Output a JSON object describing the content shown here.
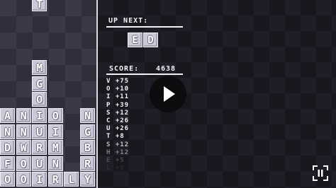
{
  "board": {
    "tiles": [
      {
        "letter": "T",
        "col": 2,
        "row": 0
      },
      {
        "letter": "M",
        "col": 2,
        "row": 4
      },
      {
        "letter": "G",
        "col": 2,
        "row": 5
      },
      {
        "letter": "O",
        "col": 2,
        "row": 6
      },
      {
        "letter": "A",
        "col": 0,
        "row": 7
      },
      {
        "letter": "N",
        "col": 1,
        "row": 7
      },
      {
        "letter": "I",
        "col": 2,
        "row": 7
      },
      {
        "letter": "O",
        "col": 3,
        "row": 7
      },
      {
        "letter": "N",
        "col": 5,
        "row": 7
      },
      {
        "letter": "N",
        "col": 0,
        "row": 8
      },
      {
        "letter": "N",
        "col": 1,
        "row": 8
      },
      {
        "letter": "U",
        "col": 2,
        "row": 8
      },
      {
        "letter": "I",
        "col": 3,
        "row": 8
      },
      {
        "letter": "G",
        "col": 5,
        "row": 8
      },
      {
        "letter": "D",
        "col": 0,
        "row": 9
      },
      {
        "letter": "W",
        "col": 1,
        "row": 9
      },
      {
        "letter": "R",
        "col": 2,
        "row": 9
      },
      {
        "letter": "M",
        "col": 3,
        "row": 9
      },
      {
        "letter": "B",
        "col": 5,
        "row": 9
      },
      {
        "letter": "F",
        "col": 0,
        "row": 10
      },
      {
        "letter": "O",
        "col": 1,
        "row": 10
      },
      {
        "letter": "U",
        "col": 2,
        "row": 10
      },
      {
        "letter": "N",
        "col": 3,
        "row": 10
      },
      {
        "letter": "R",
        "col": 5,
        "row": 10
      },
      {
        "letter": "O",
        "col": 0,
        "row": 11
      },
      {
        "letter": "O",
        "col": 1,
        "row": 11
      },
      {
        "letter": "I",
        "col": 2,
        "row": 11
      },
      {
        "letter": "R",
        "col": 3,
        "row": 11
      },
      {
        "letter": "L",
        "col": 4,
        "row": 11
      },
      {
        "letter": "Y",
        "col": 5,
        "row": 11
      }
    ]
  },
  "panel": {
    "up_next_label": "UP NEXT:",
    "next_tiles": [
      "E",
      "D"
    ],
    "score_label": "SCORE:",
    "score_value": "4638",
    "letter_values": [
      {
        "text": "V +75",
        "opacity": 1
      },
      {
        "text": "O +10",
        "opacity": 1
      },
      {
        "text": "I +11",
        "opacity": 1
      },
      {
        "text": "P +39",
        "opacity": 1
      },
      {
        "text": "S +12",
        "opacity": 1
      },
      {
        "text": "C +26",
        "opacity": 1
      },
      {
        "text": "U +26",
        "opacity": 1
      },
      {
        "text": "T +8",
        "opacity": 1
      },
      {
        "text": "S +12",
        "opacity": 0.75
      },
      {
        "text": "H +12",
        "opacity": 0.45
      },
      {
        "text": "E +5",
        "opacity": 0.22
      },
      {
        "text": "L +8",
        "opacity": 0.08
      }
    ]
  },
  "controls": {
    "play_icon": "play-icon",
    "pause_icon": "pause-icon"
  }
}
